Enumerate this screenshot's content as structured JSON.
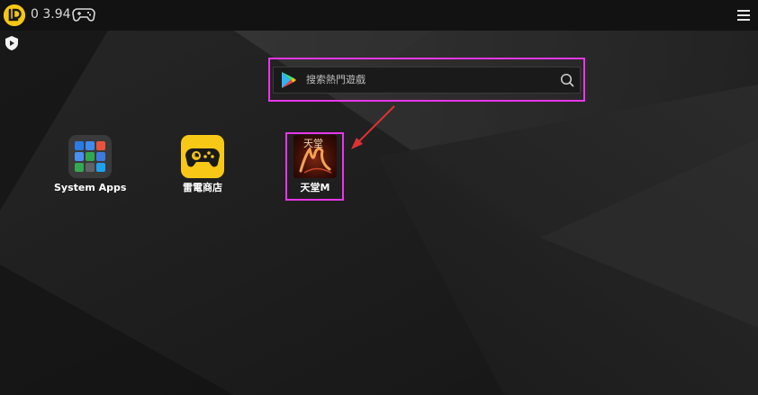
{
  "titlebar": {
    "version": "0 3.94",
    "icons": [
      "ldplayer-logo-icon",
      "gamepad-icon",
      "menu-icon"
    ]
  },
  "desktop": {
    "search": {
      "placeholder": "搜索熱門遊戲",
      "icons": [
        "play-store-icon",
        "search-icon"
      ]
    },
    "apps": [
      {
        "label": "System Apps",
        "icon": "system-apps-folder-icon"
      },
      {
        "label": "雷電商店",
        "icon": "ld-store-icon"
      },
      {
        "label": "天堂M",
        "icon": "lineage-m-icon",
        "icon_text": "天堂"
      }
    ],
    "annotation": {
      "highlight_color": "#e935e9",
      "arrow_color": "#e03232"
    }
  },
  "colors": {
    "accent": "#f7c713",
    "titlebar_bg": "#121212",
    "desktop_bg": "#1e1e1e"
  }
}
